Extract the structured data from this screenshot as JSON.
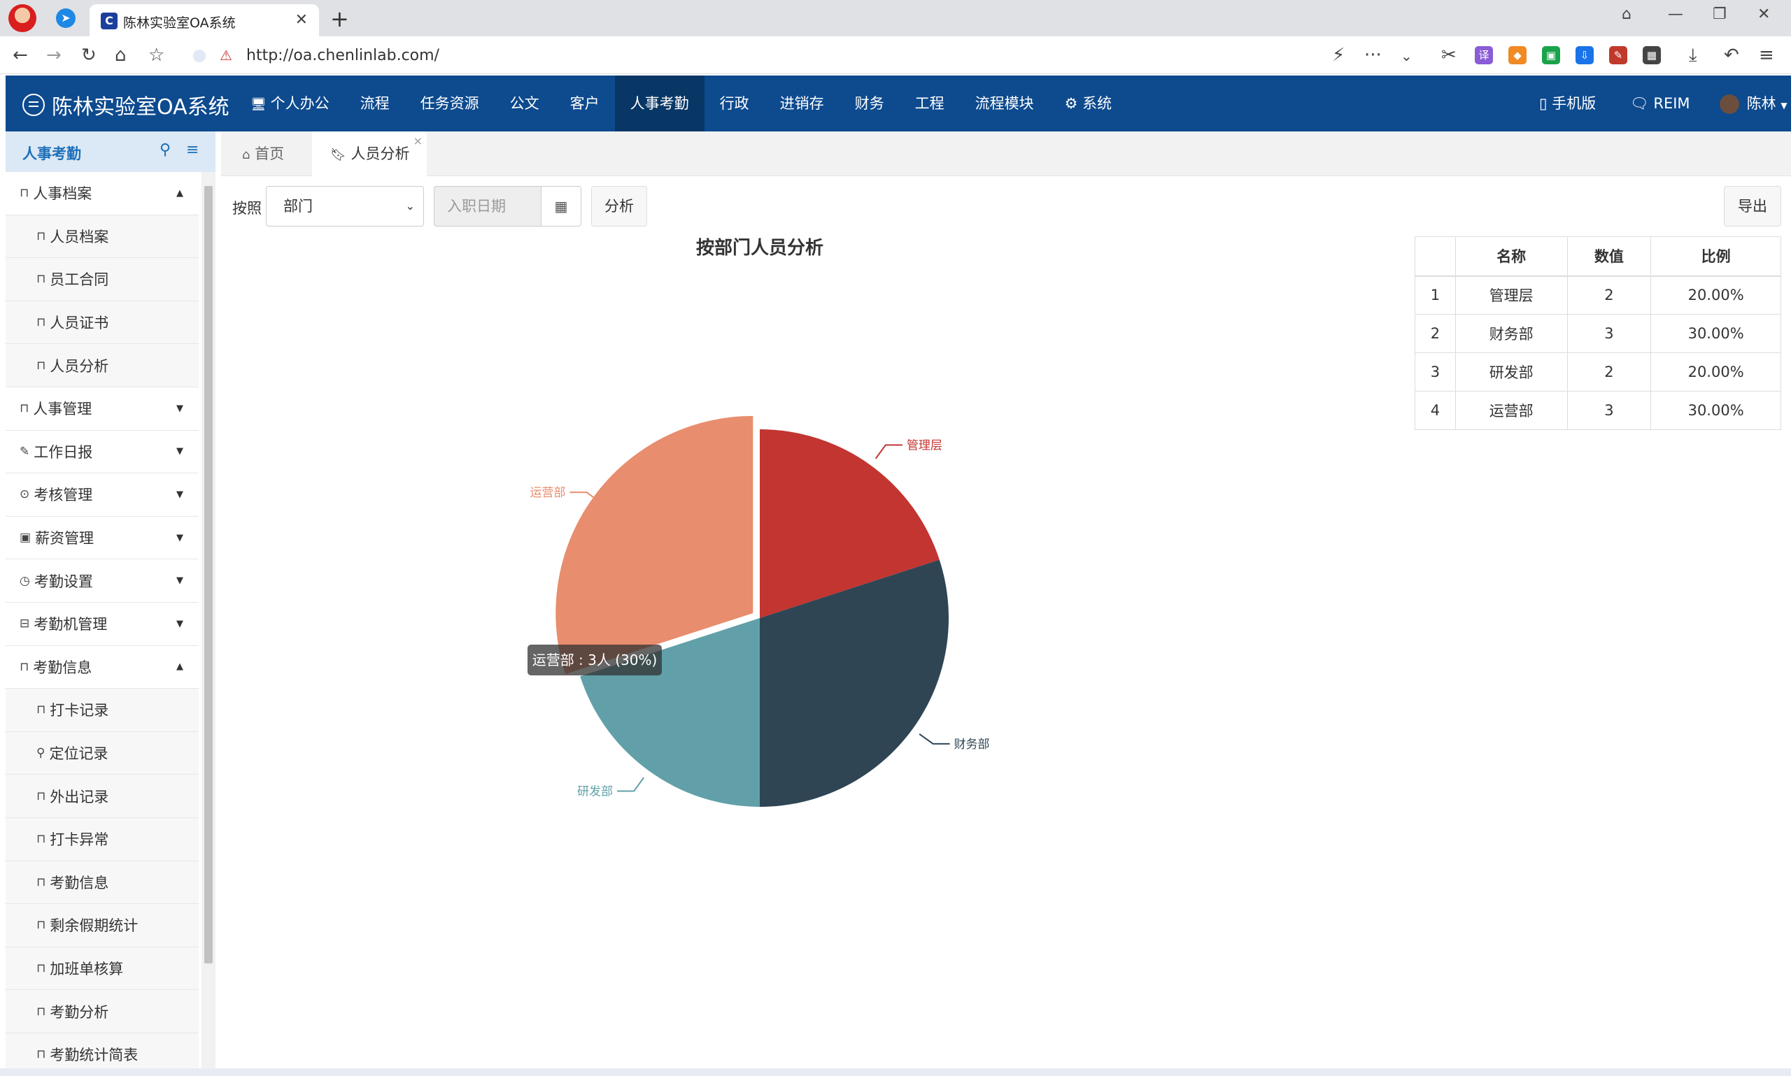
{
  "browser": {
    "tab_title": "陈林实验室OA系统",
    "url": "http://oa.chenlinlab.com/"
  },
  "app": {
    "brand": "陈林实验室OA系统",
    "menu": [
      "个人办公",
      "流程",
      "任务资源",
      "公文",
      "客户",
      "人事考勤",
      "行政",
      "进销存",
      "财务",
      "工程",
      "流程模块",
      "系统"
    ],
    "active_menu": "人事考勤",
    "right": {
      "mobile": "手机版",
      "reim": "REIM",
      "user": "陈林"
    }
  },
  "sidebar": {
    "title": "人事考勤",
    "items": [
      {
        "label": "人事档案",
        "level": 1,
        "icon": "bookmark-icon",
        "caret": "up"
      },
      {
        "label": "人员档案",
        "level": 2,
        "icon": "bookmark-icon"
      },
      {
        "label": "员工合同",
        "level": 2,
        "icon": "bookmark-icon"
      },
      {
        "label": "人员证书",
        "level": 2,
        "icon": "bookmark-icon"
      },
      {
        "label": "人员分析",
        "level": 2,
        "icon": "bookmark-icon"
      },
      {
        "label": "人事管理",
        "level": 1,
        "icon": "bookmark-icon",
        "caret": "down"
      },
      {
        "label": "工作日报",
        "level": 1,
        "icon": "edit-icon",
        "caret": "down"
      },
      {
        "label": "考核管理",
        "level": 1,
        "icon": "check-circle-icon",
        "caret": "down"
      },
      {
        "label": "薪资管理",
        "level": 1,
        "icon": "money-icon",
        "caret": "down"
      },
      {
        "label": "考勤设置",
        "level": 1,
        "icon": "clock-icon",
        "caret": "down"
      },
      {
        "label": "考勤机管理",
        "level": 1,
        "icon": "device-icon",
        "caret": "down"
      },
      {
        "label": "考勤信息",
        "level": 1,
        "icon": "bookmark-icon",
        "caret": "up"
      },
      {
        "label": "打卡记录",
        "level": 2,
        "icon": "bookmark-icon"
      },
      {
        "label": "定位记录",
        "level": 2,
        "icon": "map-marker-icon"
      },
      {
        "label": "外出记录",
        "level": 2,
        "icon": "bookmark-icon"
      },
      {
        "label": "打卡异常",
        "level": 2,
        "icon": "bookmark-icon"
      },
      {
        "label": "考勤信息",
        "level": 2,
        "icon": "bookmark-icon"
      },
      {
        "label": "剩余假期统计",
        "level": 2,
        "icon": "bookmark-icon"
      },
      {
        "label": "加班单核算",
        "level": 2,
        "icon": "bookmark-icon"
      },
      {
        "label": "考勤分析",
        "level": 2,
        "icon": "bookmark-icon"
      },
      {
        "label": "考勤统计简表",
        "level": 2,
        "icon": "bookmark-icon"
      }
    ]
  },
  "content": {
    "tabs": [
      {
        "label": "首页",
        "icon": "home-icon"
      },
      {
        "label": "人员分析",
        "icon": "bookmark-icon"
      }
    ],
    "toolbar": {
      "by_label": "按照",
      "select_value": "部门",
      "date_placeholder": "入职日期",
      "analyze_label": "分析",
      "export_label": "导出"
    },
    "tooltip": "运营部 : 3人 (30%)",
    "table": {
      "headers": [
        "",
        "名称",
        "数值",
        "比例"
      ],
      "rows": [
        [
          "1",
          "管理层",
          "2",
          "20.00%"
        ],
        [
          "2",
          "财务部",
          "3",
          "30.00%"
        ],
        [
          "3",
          "研发部",
          "2",
          "20.00%"
        ],
        [
          "4",
          "运营部",
          "3",
          "30.00%"
        ]
      ]
    }
  },
  "chart_data": {
    "type": "pie",
    "title": "按部门人员分析",
    "categories": [
      "管理层",
      "财务部",
      "研发部",
      "运营部"
    ],
    "values": [
      2,
      3,
      2,
      3
    ],
    "colors": [
      "#c23531",
      "#2f4554",
      "#61a0a8",
      "#e88d6d"
    ],
    "highlighted": "运营部"
  }
}
